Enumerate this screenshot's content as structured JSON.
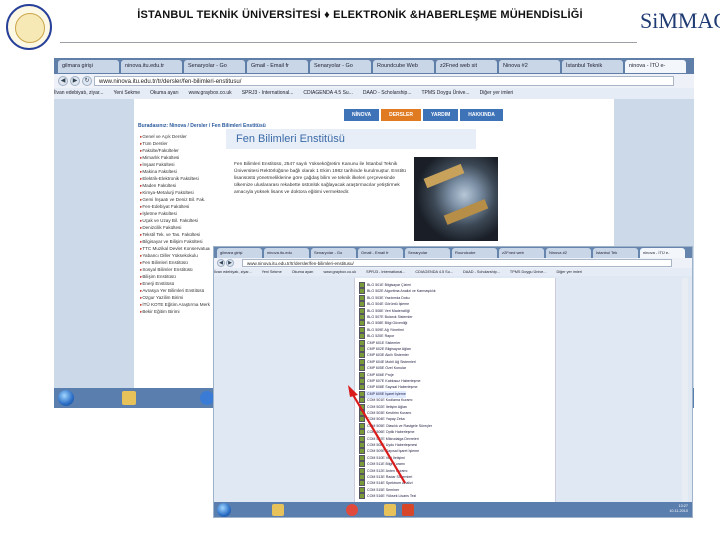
{
  "header": {
    "title": "İSTANBUL TEKNİK ÜNİVERSİTESİ ♦ ELEKTRONİK &HABERLEŞME MÜHENDİSLİĞİ",
    "logo_text": "SiMMAG",
    "seal_label": "İstanbul Teknik Üniversitesi 1773"
  },
  "shot1": {
    "tabs": [
      "gilmara girişi",
      "ninova.itu.edu.tr",
      "Senaryolar - Go",
      "Gmail - Email fr",
      "Senaryolar - Go",
      "Roundcube Web",
      "z2Fned web sit",
      "Ninova #2",
      "İstanbul Teknik",
      "ninova - İTÜ e-"
    ],
    "url": "www.ninova.itu.edu.tr/tr/dersler/fen-bilimleri-enstitusu/",
    "bookmarks": [
      "İlvan edebiyatı, ziyar...",
      "Yeni Sekme",
      "Okuma ayarı",
      "www.graybox.co.uk",
      "SPRJ3 - International...",
      "CDIAGENDA 4.5 Su...",
      "DAAD - Scholarship...",
      "TPMS Doygu Ünive...",
      "Diğer yer imleri"
    ],
    "site_tabs": [
      "NİNOVA",
      "DERSLER",
      "YARDIM",
      "HAKKINDA"
    ],
    "breadcrumb": "Buradasınız: Ninova / Dersler / Fen Bilimleri Enstitüsü",
    "nav_items": [
      "Genel ve Açık Dersler",
      "Tüm Dersler",
      "Fakülte/Fakülteler",
      "Mimarlık Fakültesi",
      "İnşaat Fakültesi",
      "Makina Fakültesi",
      "Elektrik-Elektronik Fakültesi",
      "Maden Fakültesi",
      "Kimya-Metalurji Fakültesi",
      "Gemi İnşaatı ve Deniz Bil. Fak.",
      "Fen-Edebiyat Fakültesi",
      "İşletme Fakültesi",
      "Uçak ve Uzay Bil. Fakültesi",
      "Denizcilik Fakültesi",
      "Tekstil Tek. ve Tas. Fakültesi",
      "Bilgisayar ve Bilişim Fakültesi",
      "TTC Muzikal Devlet Konservatuarı",
      "Yabancı Diller Yüksekokulu",
      "Fen Bilimleri Enstitüsü",
      "Sosyal Bilimler Enstitüsü",
      "Bilişim Enstitüsü",
      "Enerji Enstitüsü",
      "Avrasya Yer Bilimleri Enstitüsü",
      "Ozgur Yazilim Birimi",
      "İTÜ KOTE Eğitim Araştırma Merkezi",
      "Bekir Eğitim Birimi"
    ],
    "content_title": "Fen Bilimleri Enstitüsü",
    "content_text": "Fen Bilimleri Enstitüsü, 2547 sayılı Yükseköğretim Kanunu ile İstanbul Teknik Üniversitesi Rektörlüğüne bağlı olarak 1 Ekim 1982 tarihinde kurulmuştur. Enstitü lisansüstü yönetmeliklerine göre çağdaş bilim ve teknik ilkeleri çerçevesinde ülkemize uluslararası rekabette üstünlük sağlayacak araştırmacılar yetiştirmek amacıyla yüksek lisans ve doktora eğitimi vermektedir."
  },
  "shot2": {
    "tabs": [
      "gilmara girişi",
      "ninova.itu.edu",
      "Senaryolar - Go",
      "Gmail - Email fr",
      "Senaryolar",
      "Roundcube",
      "z2Fned web",
      "Ninova #2",
      "İstanbul Tek",
      "ninova - İTÜ e-"
    ],
    "url": "www.ninova.itu.edu.tr/tr/dersler/fen-bilimleri-enstitusu/",
    "bookmarks": [
      "İlvan edebiyatı, ziyar...",
      "Yeni Sekme",
      "Okuma ayarı",
      "www.graybox.co.uk",
      "SPRJ3 - International...",
      "CDIAGENDA 4.5 Su...",
      "DAAD - Scholarship...",
      "TPMS Doygu Ünive...",
      "Diğer yer imleri"
    ],
    "rows": [
      "BLG 501E Bilgisayar Çizimi",
      "BLG 502E Algoritma Analizi ve Karmaşıklık",
      "BLG 503E Yazılımda Doku",
      "BLG 504E Görüntü İşleme",
      "BLG 506E Veri Madenciliği",
      "BLG 507E Bulanık Sistemler",
      "BLG 508E Bilgi Güvenliği",
      "BLG 509E Ağ Yönetimi",
      "BLG 520E Rapor",
      "CMP 601E Sistemler",
      "CMP 602E Bilgisayar Ağları",
      "CMP 603E Akıllı Sistemler",
      "CMP 604E Mobil Ağ Sistemleri",
      "CMP 605E Özel Konular",
      "CMP 606E Proje",
      "CMP 607E Kablosuz Haberleşme",
      "CMP 608E Sayısal Haberleşme",
      "CMP 609E İşaret İşleme",
      "COM 501E Kodlama Kuramı",
      "COM 502E İletişim Ağları",
      "COM 503E Kestirim Kuramı",
      "COM 504E Yapay Zeka",
      "COM 505E Olasılık ve Rastgele Süreçler",
      "COM 506E Optik Haberleşme",
      "COM 507E Mikrodalga Devreleri",
      "COM 508E Uydu Haberleşmesi",
      "COM 509E Sayısal İşaret İşleme",
      "COM 510E Veri İletişimi",
      "COM 511E Bilgi Kuramı",
      "COM 512E Anten Kuramı",
      "COM 513E Radar Sistemleri",
      "COM 514E Spektrum Analizi",
      "COM 515E Seminer",
      "COM 516E Yüksek Lisans Tezi"
    ],
    "selected_index": 17,
    "clock_time": "13:27",
    "clock_date": "10.11.2010"
  },
  "colors": {
    "arrow": "#d91b1b",
    "site_tab_blue": "#3f73b8",
    "site_tab_orange": "#e07b22",
    "header_rule": "#9aa0a6"
  }
}
